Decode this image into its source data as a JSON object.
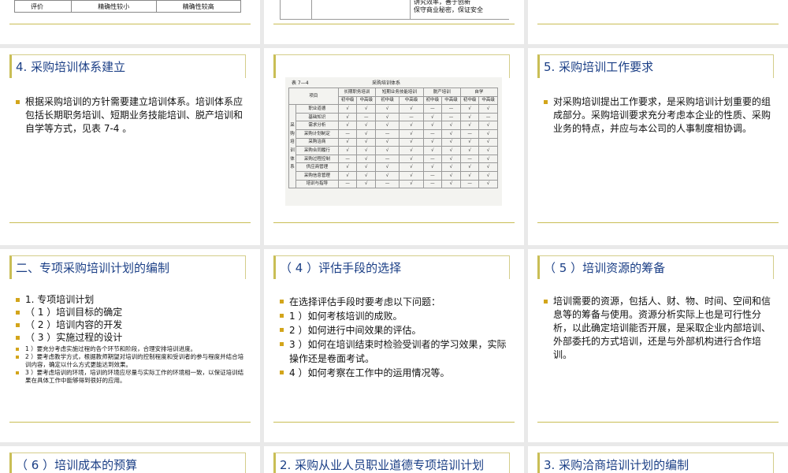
{
  "top": {
    "left_table": {
      "row": [
        "评价",
        "精确性较小",
        "精确性较高"
      ]
    },
    "mid_lines": [
      "讲究效率，善于创新",
      "保守商业秘密，保证安全"
    ]
  },
  "slides": {
    "s4": {
      "title": "4. 采购培训体系建立",
      "bullets": [
        "根据采购培训的方针需要建立培训体系。培训体系应包括长期职务培训、短期业务技能培训、脱产培训和自学等方式，见表 7-4 。"
      ]
    },
    "s_img": {
      "caption_left": "表 7—4",
      "caption_center": "采购培训体系",
      "header1": [
        "项目",
        "长期职务培训",
        "短期业务技能培训",
        "脱产培训",
        "自学"
      ],
      "header2": [
        "初中级",
        "中高级",
        "初中级",
        "中高级",
        "初中级",
        "中高级",
        "初中级",
        "中高级"
      ],
      "side_label": [
        "采",
        "购",
        "培",
        "训",
        "体",
        "系"
      ],
      "rows": [
        {
          "label": "职业道德",
          "marks": [
            "√",
            "√",
            "√",
            "√",
            "—",
            "—",
            "√",
            "√"
          ]
        },
        {
          "label": "基础知识",
          "marks": [
            "√",
            "—",
            "√",
            "—",
            "√",
            "—",
            "√",
            "—"
          ]
        },
        {
          "label": "需求分析",
          "marks": [
            "√",
            "√",
            "√",
            "√",
            "√",
            "√",
            "√",
            "√"
          ]
        },
        {
          "label": "采购计划制定",
          "marks": [
            "—",
            "√",
            "—",
            "√",
            "—",
            "√",
            "—",
            "√"
          ]
        },
        {
          "label": "采购洽商",
          "marks": [
            "√",
            "√",
            "√",
            "√",
            "√",
            "√",
            "√",
            "√"
          ]
        },
        {
          "label": "采购合同履行",
          "marks": [
            "√",
            "√",
            "√",
            "√",
            "√",
            "√",
            "√",
            "√"
          ]
        },
        {
          "label": "采购过程控制",
          "marks": [
            "—",
            "√",
            "—",
            "√",
            "—",
            "√",
            "—",
            "√"
          ]
        },
        {
          "label": "供应商管理",
          "marks": [
            "√",
            "√",
            "√",
            "√",
            "√",
            "√",
            "√",
            "√"
          ]
        },
        {
          "label": "采购信息管理",
          "marks": [
            "√",
            "√",
            "√",
            "√",
            "—",
            "√",
            "√",
            "√"
          ]
        },
        {
          "label": "培训与指导",
          "marks": [
            "—",
            "√",
            "—",
            "√",
            "—",
            "√",
            "—",
            "√"
          ]
        }
      ]
    },
    "s5": {
      "title": "5. 采购培训工作要求",
      "bullets": [
        "对采购培训提出工作要求，是采购培训计划重要的组成部分。采购培训要求充分考虑本企业的性质、采购业务的特点，并应与本公司的人事制度相协调。"
      ]
    },
    "s_two": {
      "title": "二、专项采购培训计划的编制",
      "bullets": [
        "1. 专项培训计划",
        "（ 1 ）培训目标的确定",
        "（ 2 ）培训内容的开发",
        "（ 3 ）实施过程的设计"
      ],
      "small": [
        "1 ）要充分考虑实施过程的各个环节和阶段，合理安排培训进度。",
        "2 ）要考虑教学方式，根据教师期望对培训的控制程度和受训者的参与程度并结合培训内容，确定以什么方式更能达到效果。",
        "3 ）要考虑培训的环境，培训的环境应尽量与实际工作的环境相一致，以保证培训结果在具体工作中能够得到很好的应用。"
      ]
    },
    "s_eval": {
      "title": "（ 4 ）评估手段的选择",
      "bullets": [
        "在选择评估手段时要考虑以下问题：",
        "1 ）如何考核培训的成败。",
        "2 ）如何进行中间效果的评估。",
        "3 ）如何在培训结束时检验受训者的学习效果，实际操作还是卷面考试。",
        "4 ）如何考察在工作中的运用情况等。"
      ]
    },
    "s_res": {
      "title": "（ 5 ）培训资源的筹备",
      "bullets": [
        "培训需要的资源，包括人、财、物、时间、空间和信息等的筹备与使用。资源分析实际上也是可行性分析，以此确定培训能否开展，是采取企业内部培训、外部委托的方式培训，还是与外部机构进行合作培训。"
      ]
    },
    "s6": {
      "title": "（ 6 ）培训成本的预算"
    },
    "s_eth": {
      "title": "2. 采购从业人员职业道德专项培训计划"
    },
    "s_neg": {
      "title": "3. 采购洽商培训计划的编制"
    }
  }
}
